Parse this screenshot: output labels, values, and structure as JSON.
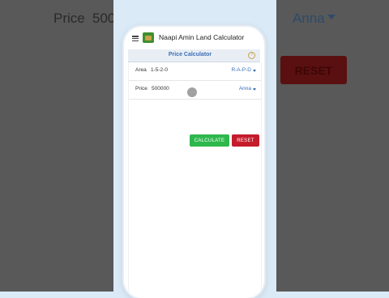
{
  "background": {
    "price_label": "Price",
    "price_value": "500",
    "unit_label": "Anna",
    "reset_label": "RESET"
  },
  "app": {
    "title": "Naapi Amin Land Calculator",
    "section_title": "Price Calculator",
    "help_glyph": "?"
  },
  "form": {
    "area_label": "Area",
    "area_value": "1-5-2-0",
    "area_unit": "R-A-P-D",
    "price_label": "Price",
    "price_value": "500000",
    "price_unit": "Anna"
  },
  "buttons": {
    "calculate_label": "CALCULATE",
    "reset_label": "RESET"
  },
  "colors": {
    "calculate": "#2eb84c",
    "reset": "#c51c2c",
    "accent": "#3b6fb4"
  }
}
